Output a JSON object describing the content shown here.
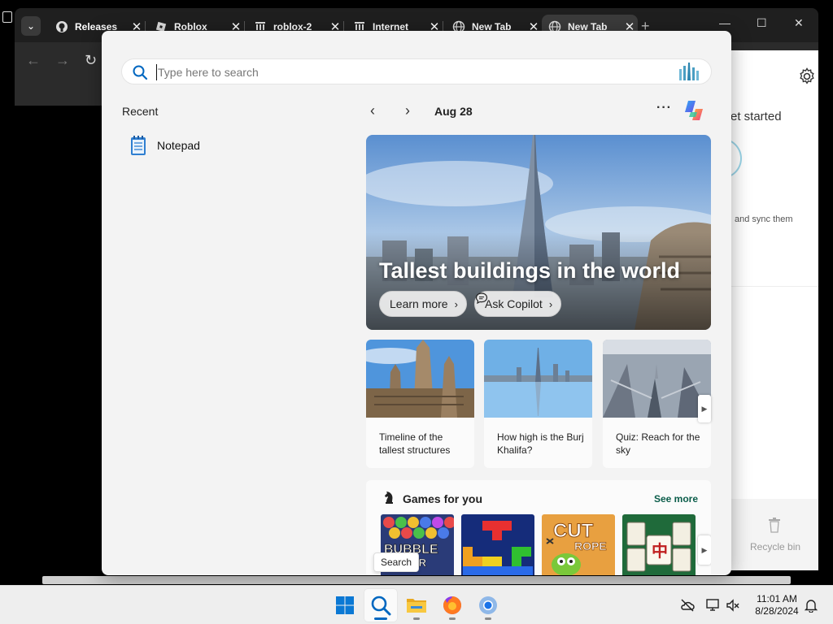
{
  "browser": {
    "tabs": [
      {
        "label": "Releases",
        "icon": "github-icon",
        "active": false
      },
      {
        "label": "Roblox",
        "icon": "roblox-icon",
        "active": false
      },
      {
        "label": "roblox-2",
        "icon": "archive-icon",
        "active": false
      },
      {
        "label": "Internet",
        "icon": "archive-icon",
        "active": false
      },
      {
        "label": "New Tab",
        "icon": "globe-icon",
        "active": false
      },
      {
        "label": "New Tab",
        "icon": "globe-icon",
        "active": true
      }
    ],
    "new_tab_symbol": "+",
    "minimize_symbol": "—",
    "maximize_symbol": "☐",
    "close_symbol": "✕",
    "tab_list_symbol": "⌄",
    "tab_close_symbol": "✕",
    "back_symbol": "←",
    "forward_symbol": "→",
    "reload_symbol": "↻"
  },
  "side_panel": {
    "get_started": "et started",
    "sync_text": "and sync them",
    "recycle_bin": "Recycle bin"
  },
  "search": {
    "placeholder": "Type here to search",
    "recent_title": "Recent",
    "recent_items": [
      {
        "label": "Notepad",
        "icon": "notepad-icon"
      }
    ],
    "tooltip": "Search"
  },
  "highlights": {
    "date": "Aug 28",
    "prev_symbol": "‹",
    "next_symbol": "›",
    "more_symbol": "···",
    "hero": {
      "title": "Tallest buildings in the world",
      "learn_more": "Learn more",
      "ask_copilot": "Ask Copilot",
      "chevron": "›"
    },
    "cards": [
      {
        "text": "Timeline of the tallest structures"
      },
      {
        "text": "How high is the Burj Khalifa?"
      },
      {
        "text": "Quiz: Reach for the sky"
      }
    ],
    "carousel_next": "▶"
  },
  "games": {
    "title": "Games for you",
    "see_more": "See more",
    "items": [
      {
        "name": "Bubble Shooter",
        "art_text": "BUBBLE",
        "art_subtext": "TER"
      },
      {
        "name": "Blocks"
      },
      {
        "name": "Cut the Rope",
        "art_text": "CUT",
        "art_subtext": "ROPE"
      },
      {
        "name": "Mahjong",
        "art_text": "中"
      }
    ]
  },
  "taskbar": {
    "time": "11:01 AM",
    "date": "8/28/2024",
    "apps": [
      "start",
      "search",
      "file-explorer",
      "firefox",
      "chrome"
    ]
  },
  "colors": {
    "accent": "#0067c0",
    "see_more": "#0b5d4a",
    "flyout_bg": "#f3f3f3"
  }
}
